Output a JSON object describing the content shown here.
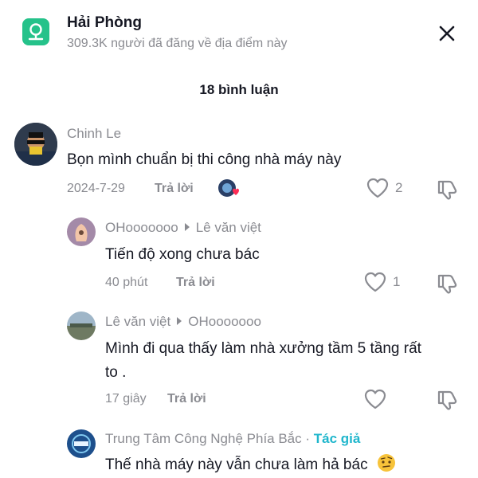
{
  "header": {
    "location_name": "Hải Phòng",
    "location_subtitle": "309.3K người đã đăng về địa điểm này",
    "badge_color": "#25c28a",
    "icon": "map-pin-icon",
    "close_icon": "close-icon"
  },
  "comments_count_label": "18 bình luận",
  "comments": [
    {
      "author": "Chinh Le",
      "text": "Bọn mình chuẩn bị thi công nhà máy này",
      "time": "2024-7-29",
      "reply_label": "Trả lời",
      "likes": "2"
    }
  ],
  "replies": [
    {
      "author": "OHooooooo",
      "reply_to": "Lê văn việt",
      "text": "Tiến độ xong chưa bác",
      "time": "40 phút",
      "reply_label": "Trả lời",
      "likes": "1"
    },
    {
      "author": "Lê văn việt",
      "reply_to": "OHooooooo",
      "text": "Mình đi qua thấy làm nhà xưởng tầm 5 tầng rất to .",
      "time": "17 giây",
      "reply_label": "Trả lời",
      "likes": ""
    },
    {
      "author": "Trung Tâm Công Nghệ Phía Bắc",
      "author_tag": "Tác giả",
      "separator": "·",
      "text": "Thế nhà máy này vẫn chưa làm hả bác"
    }
  ],
  "colors": {
    "accent": "#1fb6cc",
    "muted": "#8a8b91",
    "text": "#161823",
    "liked_heart": "#fe2c55"
  }
}
